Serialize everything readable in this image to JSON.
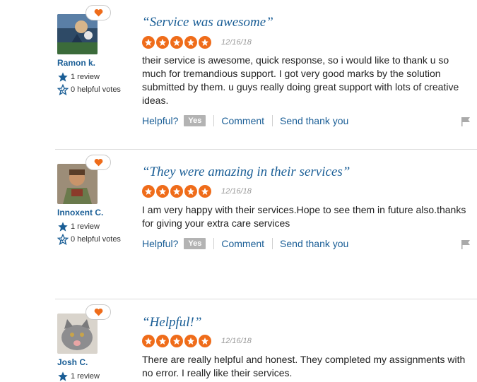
{
  "labels": {
    "helpful": "Helpful?",
    "yes": "Yes",
    "comment": "Comment",
    "send_thank_you": "Send thank you"
  },
  "reviews": [
    {
      "user": "Ramon k.",
      "reviews_count": "1 review",
      "helpful_votes": "0 helpful votes",
      "title": "“Service was awesome”",
      "rating": 5,
      "date": "12/16/18",
      "text": "their service is awesome, quick response, so i would like to thank u so much for tremandious support. I got very good marks by the solution submitted by them. u guys really doing great support with lots of creative ideas."
    },
    {
      "user": "Innoxent C.",
      "reviews_count": "1 review",
      "helpful_votes": "0 helpful votes",
      "title": "“They were amazing in their services”",
      "rating": 5,
      "date": "12/16/18",
      "text": "I am very happy with their services.Hope to see them in future also.thanks for giving your extra care services"
    },
    {
      "user": "Josh C.",
      "reviews_count": "1 review",
      "title": "“Helpful!”",
      "rating": 5,
      "date": "12/16/18",
      "text": "There are really helpful and honest. They completed my assignments with no error. I really like their services."
    }
  ],
  "colors": {
    "link": "#1a5e96",
    "star": "#ef6c1a",
    "heart": "#ef6c1a"
  }
}
